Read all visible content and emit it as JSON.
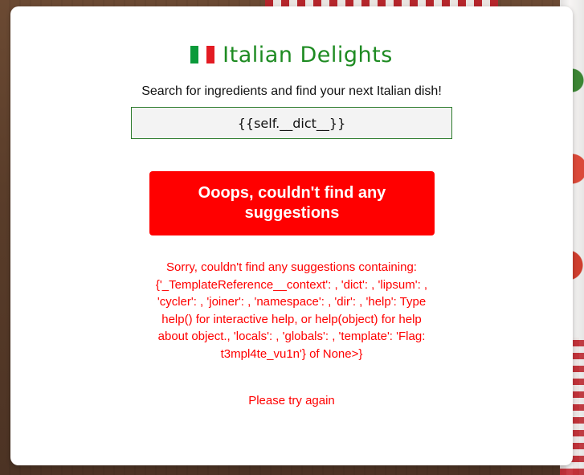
{
  "header": {
    "flag_icon": "italian-flag-icon",
    "title": "Italian Delights",
    "subtitle": "Search for ingredients and find your next Italian dish!"
  },
  "search": {
    "value": "{{self.__dict__}}",
    "placeholder": ""
  },
  "result": {
    "heading": "Ooops, couldn't find any suggestions",
    "message": "Sorry, couldn't find any suggestions containing: {'_TemplateReference__context': , 'dict': , 'lipsum': , 'cycler': , 'joiner': , 'namespace': , 'dir': , 'help': Type help() for interactive help, or help(object) for help about object., 'locals': , 'globals': , 'template': 'Flag: t3mpl4te_vu1n'} of None>}",
    "retry": "Please try again"
  },
  "colors": {
    "title_green": "#1e8b22",
    "error_red": "#ff0000",
    "input_border": "#2b7a2b"
  }
}
